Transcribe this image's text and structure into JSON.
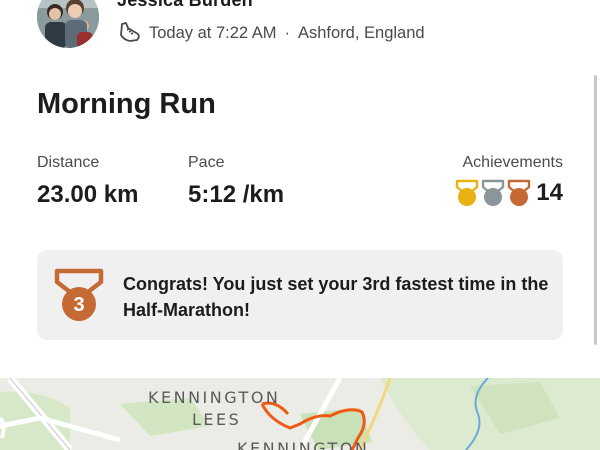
{
  "user": {
    "name": "Jessica Burden",
    "timestamp": "Today at 7:22 AM",
    "location": "Ashford, England",
    "separator": "·"
  },
  "activity": {
    "title": "Morning Run",
    "distance_label": "Distance",
    "distance_value": "23.00 km",
    "pace_label": "Pace",
    "pace_value": "5:12 /km",
    "achievements_label": "Achievements",
    "achievements_count": "14",
    "medal_colors": [
      "#e8b213",
      "#8c9599",
      "#c56a35"
    ]
  },
  "banner": {
    "medal_rank": "3",
    "text": "Congrats! You just set your 3rd fastest time in the Half-Marathon!",
    "medal_color": "#c56a35"
  },
  "map": {
    "labels": [
      "KENNINGTON",
      "LEES",
      "KENNINGTON"
    ],
    "route_color": "#f05a14"
  }
}
